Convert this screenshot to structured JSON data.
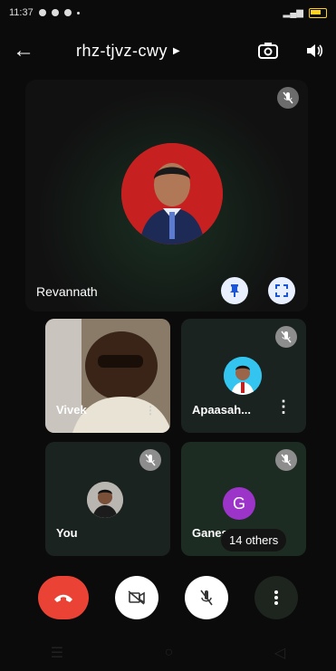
{
  "status_bar": {
    "time": "11:37"
  },
  "header": {
    "meeting_code": "rhz-tjvz-cwy"
  },
  "main_tile": {
    "name": "Revannath"
  },
  "tiles": [
    {
      "name": "Vivek"
    },
    {
      "name": "Apaasah..."
    },
    {
      "name": "You"
    },
    {
      "name": "Ganes",
      "letter": "G"
    }
  ],
  "others_chip": {
    "label": "14 others"
  },
  "colors": {
    "end_call": "#ea4335",
    "avatar_purple": "#9c34c9",
    "action_pill": "#e8efff"
  }
}
